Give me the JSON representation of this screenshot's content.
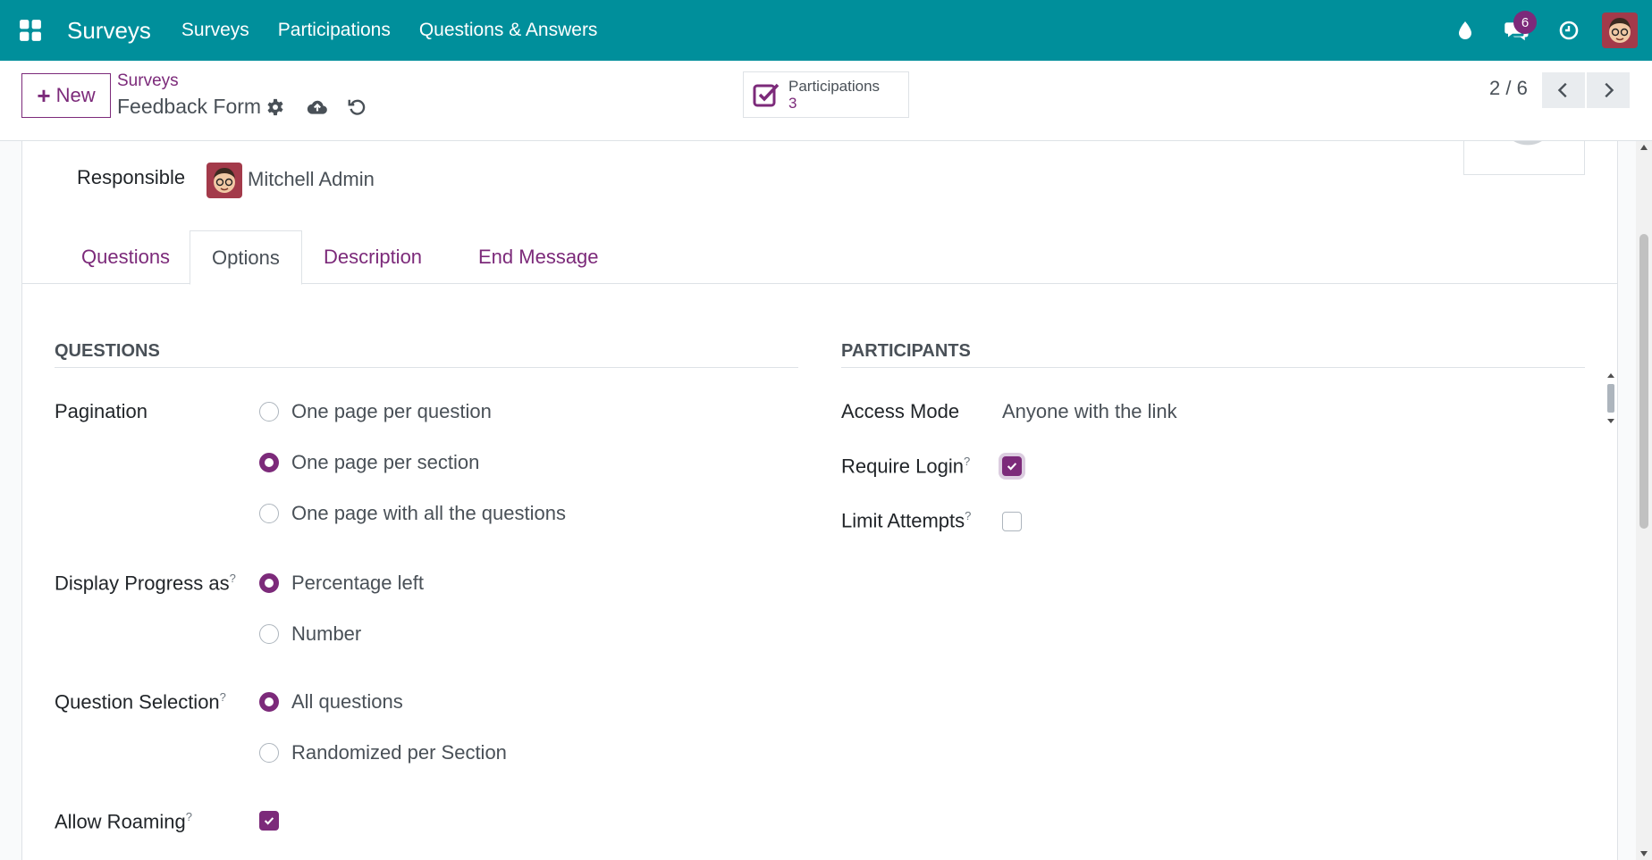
{
  "navbar": {
    "brand": "Surveys",
    "menu": [
      "Surveys",
      "Participations",
      "Questions & Answers"
    ],
    "messages_badge": "6",
    "bg_color": "#008f9b"
  },
  "control": {
    "new_label": "New",
    "breadcrumb_parent": "Surveys",
    "record_title": "Feedback Form",
    "smart_button": {
      "label": "Participations",
      "count": "3"
    },
    "pager": "2 / 6"
  },
  "form": {
    "responsible_label": "Responsible",
    "responsible_name": "Mitchell Admin",
    "tabs": [
      "Questions",
      "Options",
      "Description",
      "End Message"
    ],
    "active_tab": "Options",
    "questions_section": {
      "title": "QUESTIONS",
      "pagination_label": "Pagination",
      "pagination_options": [
        "One page per question",
        "One page per section",
        "One page with all the questions"
      ],
      "pagination_selected": "One page per section",
      "progress_label": "Display Progress as",
      "progress_options": [
        "Percentage left",
        "Number"
      ],
      "progress_selected": "Percentage left",
      "selection_label": "Question Selection",
      "selection_options": [
        "All questions",
        "Randomized per Section"
      ],
      "selection_selected": "All questions",
      "roaming_label": "Allow Roaming",
      "roaming_checked": true
    },
    "participants_section": {
      "title": "PARTICIPANTS",
      "access_mode_label": "Access Mode",
      "access_mode_value": "Anyone with the link",
      "require_login_label": "Require Login",
      "require_login_checked": true,
      "limit_attempts_label": "Limit Attempts",
      "limit_attempts_checked": false
    },
    "help_marker": "?"
  },
  "colors": {
    "accent": "#7c2a7a",
    "navbar": "#008f9b"
  }
}
